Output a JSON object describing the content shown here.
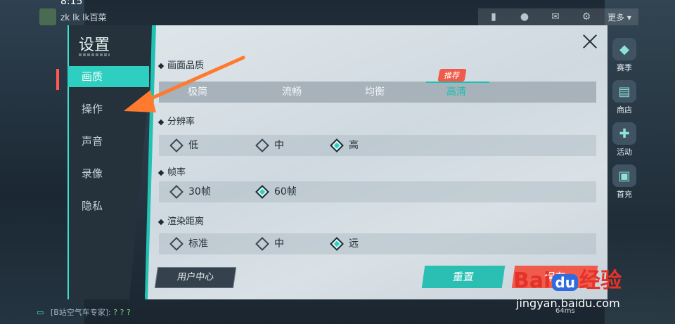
{
  "status": {
    "time": "8:15"
  },
  "top": {
    "player_name": "zk lk lk百菜",
    "more_label": "更多",
    "toolbar_icons": [
      "chart-icon",
      "friends-icon",
      "mail-icon",
      "gear-icon"
    ]
  },
  "right_icons": [
    {
      "label": "赛季",
      "icon": "season-icon"
    },
    {
      "label": "商店",
      "icon": "shop-icon"
    },
    {
      "label": "活动",
      "icon": "gamepad-icon"
    },
    {
      "label": "首充",
      "icon": "gift-icon"
    }
  ],
  "chat": {
    "text": "[B站空气车专家]:",
    "suffix": "? ? ?"
  },
  "ping": "64ms",
  "dialog": {
    "title": "设置",
    "nav": [
      "画质",
      "操作",
      "声音",
      "录像",
      "隐私"
    ],
    "active_nav": "画质",
    "sections": {
      "quality": {
        "label": "画面品质",
        "options": [
          "极简",
          "流畅",
          "均衡",
          "高清"
        ],
        "selected": "高清",
        "badge": "推荐"
      },
      "resolution": {
        "label": "分辨率",
        "options": [
          "低",
          "中",
          "高"
        ],
        "selected": "高"
      },
      "framerate": {
        "label": "帧率",
        "options": [
          "30帧",
          "60帧"
        ],
        "selected": "60帧"
      },
      "render_distance": {
        "label": "渲染距离",
        "options": [
          "标准",
          "中",
          "远"
        ],
        "selected": "远"
      }
    },
    "buttons": {
      "user_center": "用户中心",
      "reset": "重置",
      "save": "保存"
    }
  },
  "watermark": {
    "brand_prefix": "Bai",
    "brand_du": "du",
    "brand_suffix": "经验",
    "url": "jingyan.baidu.com"
  },
  "colors": {
    "accent": "#2ecfc0",
    "save": "#ef5b4d",
    "badge": "#f05a4a",
    "arrow": "#ff7a2e"
  }
}
